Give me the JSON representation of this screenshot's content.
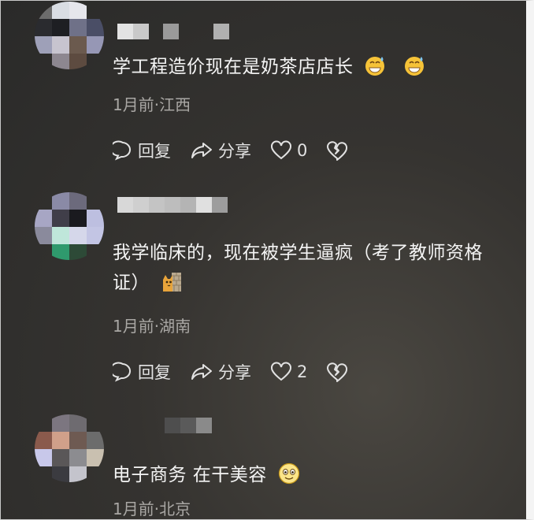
{
  "comments": [
    {
      "text": "学工程造价现在是奶茶店店长",
      "meta": "1月前·江西",
      "reply": "回复",
      "share": "分享",
      "likes": "0",
      "emojis": [
        "grin-sweat-emoji",
        "grin-sweat-emoji"
      ]
    },
    {
      "text": "我学临床的，现在被学生逼疯（考了教师资格证）",
      "meta": "1月前·湖南",
      "reply": "回复",
      "share": "分享",
      "likes": "2",
      "emojis": [
        "cat-behind-wall-emoji"
      ]
    },
    {
      "text": "电子商务 在干美容",
      "meta": "1月前·北京",
      "emojis": [
        "smile-emoji"
      ]
    }
  ]
}
